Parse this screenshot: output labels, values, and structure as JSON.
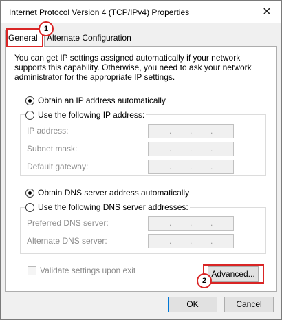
{
  "window": {
    "title": "Internet Protocol Version 4 (TCP/IPv4) Properties",
    "close_glyph": "✕"
  },
  "tabs": [
    {
      "label": "General"
    },
    {
      "label": "Alternate Configuration"
    }
  ],
  "description": "You can get IP settings assigned automatically if your network supports this capability. Otherwise, you need to ask your network administrator for the appropriate IP settings.",
  "ip_options": {
    "auto_label": "Obtain an IP address automatically",
    "manual_label": "Use the following IP address:",
    "auto_selected": true,
    "fields": [
      {
        "label": "IP address:",
        "value": ". . ."
      },
      {
        "label": "Subnet mask:",
        "value": ". . ."
      },
      {
        "label": "Default gateway:",
        "value": ". . ."
      }
    ]
  },
  "dns_options": {
    "auto_label": "Obtain DNS server address automatically",
    "manual_label": "Use the following DNS server addresses:",
    "auto_selected": true,
    "fields": [
      {
        "label": "Preferred DNS server:",
        "value": ". . ."
      },
      {
        "label": "Alternate DNS server:",
        "value": ". . ."
      }
    ]
  },
  "validate_label": "Validate settings upon exit",
  "buttons": {
    "advanced": "Advanced...",
    "ok": "OK",
    "cancel": "Cancel"
  },
  "annotations": [
    {
      "number": "1"
    },
    {
      "number": "2"
    }
  ],
  "colors": {
    "annotation": "#d92525",
    "default_button_border": "#0078d7"
  }
}
